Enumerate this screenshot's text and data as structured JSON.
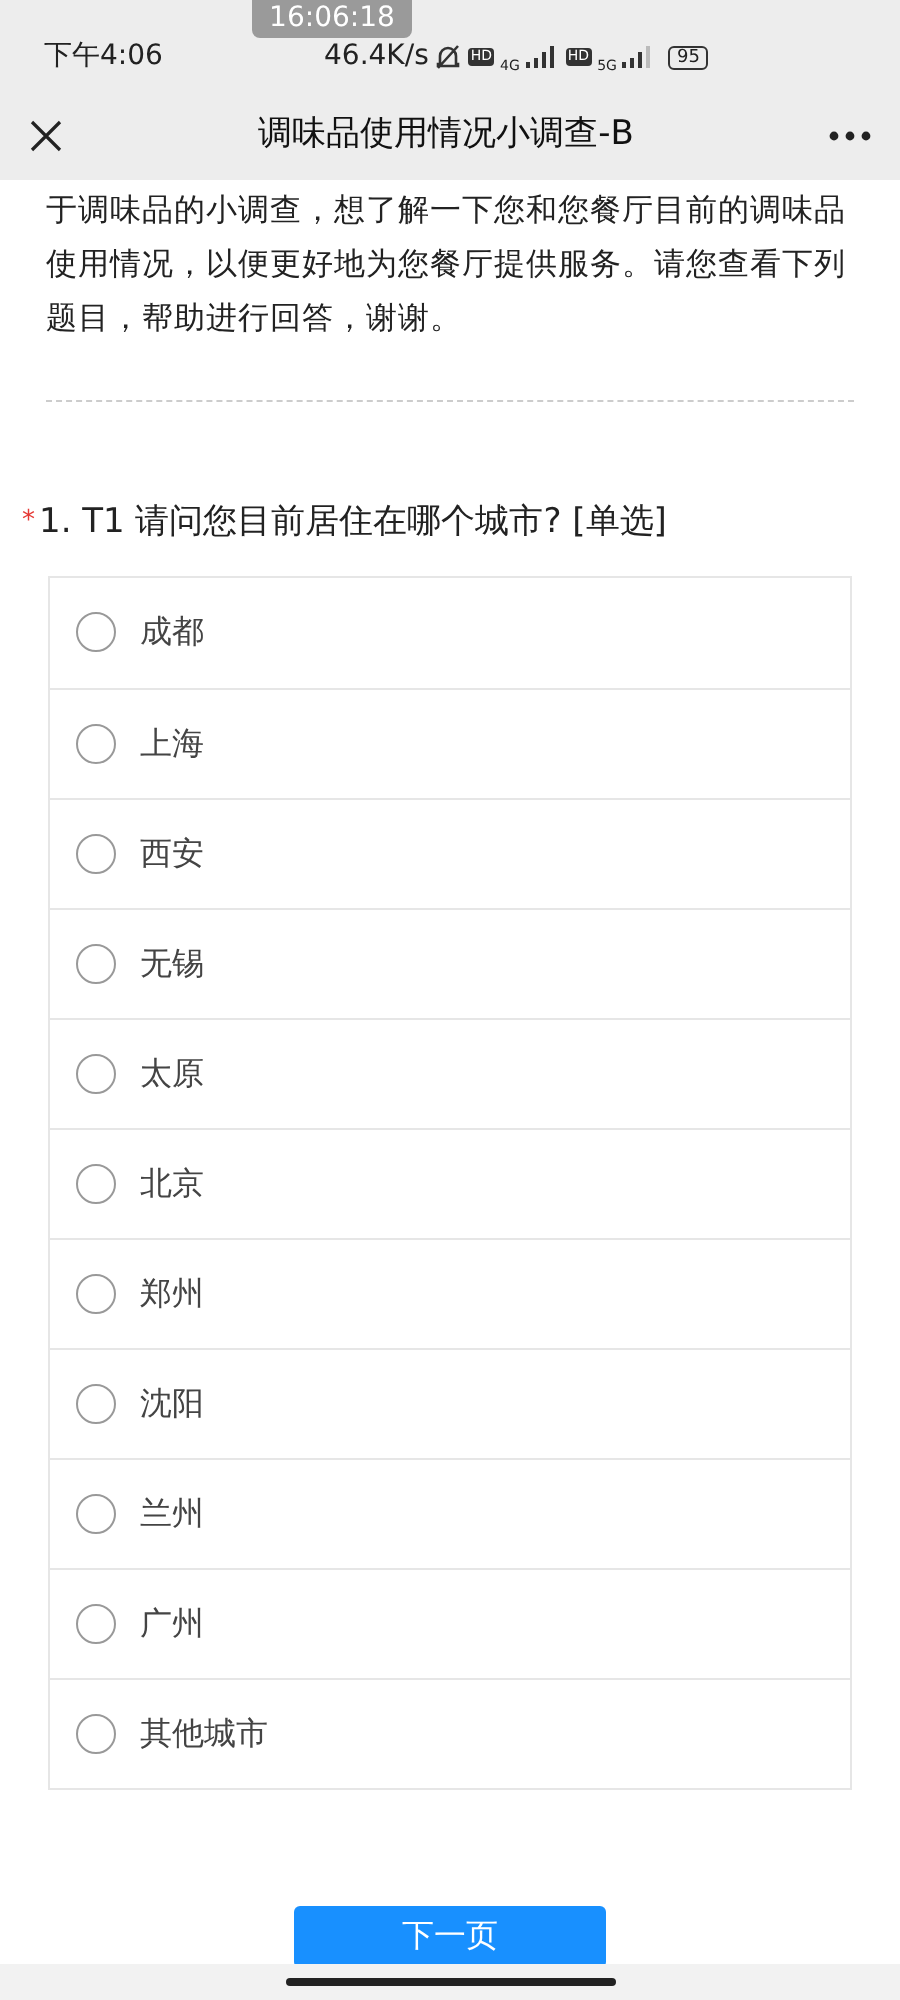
{
  "timestamp_overlay": "16:06:18",
  "status_bar": {
    "time": "下午4:06",
    "speed": "46.4K/s",
    "sim1_badge": "HD",
    "sim1_network": "4G",
    "sim2_badge": "HD",
    "sim2_network": "5G",
    "battery": "95"
  },
  "header": {
    "title": "调味品使用情况小调查-B"
  },
  "intro": "于调味品的小调查，想了解一下您和您餐厅目前的调味品使用情况，以便更好地为您餐厅提供服务。请您查看下列题目，帮助进行回答，谢谢。",
  "question": {
    "required_mark": "*",
    "title": "1. T1 请问您目前居住在哪个城市? [单选]",
    "options": [
      {
        "label": "成都",
        "selected": false
      },
      {
        "label": "上海",
        "selected": false
      },
      {
        "label": "西安",
        "selected": false
      },
      {
        "label": "无锡",
        "selected": false
      },
      {
        "label": "太原",
        "selected": false
      },
      {
        "label": "北京",
        "selected": false
      },
      {
        "label": "郑州",
        "selected": false
      },
      {
        "label": "沈阳",
        "selected": false
      },
      {
        "label": "兰州",
        "selected": false
      },
      {
        "label": "广州",
        "selected": false
      },
      {
        "label": "其他城市",
        "selected": false
      }
    ]
  },
  "next_button": "下一页"
}
